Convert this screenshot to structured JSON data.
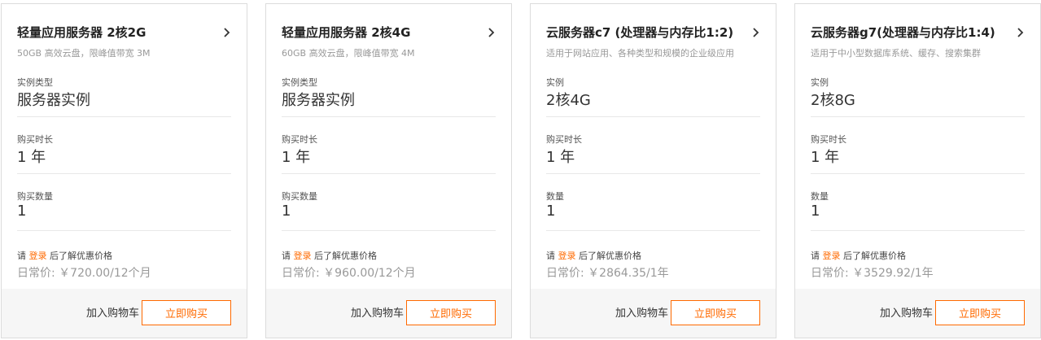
{
  "common": {
    "duration_label": "购买时长",
    "duration_value": "1 年",
    "login_prefix": "请 ",
    "login_link": "登录",
    "login_suffix": " 后了解优惠价格",
    "add_to_cart": "加入购物车",
    "buy_now": "立即购买",
    "accent_color": "#ff6a00"
  },
  "cards": [
    {
      "title": "轻量应用服务器 2核2G",
      "subtitle": "50GB 高效云盘，限峰值带宽 3M",
      "type_label": "实例类型",
      "type_value": "服务器实例",
      "qty_label": "购买数量",
      "qty_value": "1",
      "price": "日常价: ￥720.00/12个月"
    },
    {
      "title": "轻量应用服务器 2核4G",
      "subtitle": "60GB 高效云盘，限峰值带宽 4M",
      "type_label": "实例类型",
      "type_value": "服务器实例",
      "qty_label": "购买数量",
      "qty_value": "1",
      "price": "日常价: ￥960.00/12个月"
    },
    {
      "title": "云服务器c7 (处理器与内存比1:2)",
      "subtitle": "适用于网站应用、各种类型和规模的企业级应用",
      "type_label": "实例",
      "type_value": "2核4G",
      "qty_label": "数量",
      "qty_value": "1",
      "price": "日常价: ￥2864.35/1年"
    },
    {
      "title": "云服务器g7(处理器与内存比1:4)",
      "subtitle": "适用于中小型数据库系统、缓存、搜索集群",
      "type_label": "实例",
      "type_value": "2核8G",
      "qty_label": "数量",
      "qty_value": "1",
      "price": "日常价: ￥3529.92/1年"
    }
  ]
}
